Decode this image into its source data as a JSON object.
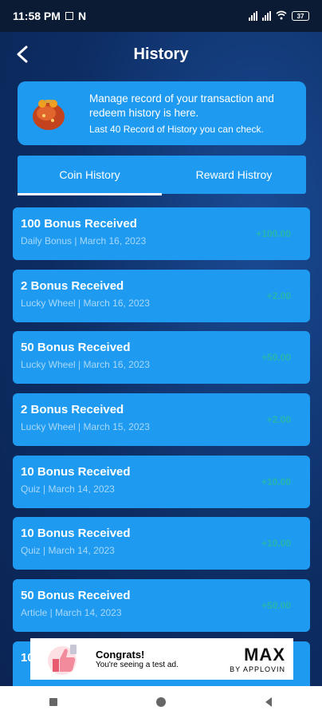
{
  "status_bar": {
    "time": "11:58 PM",
    "indicators": "N",
    "battery": "37"
  },
  "header": {
    "title": "History",
    "back_icon": "chevron-left-icon"
  },
  "info": {
    "line1": "Manage record of your transaction and redeem history is here.",
    "line2": "Last 40 Record of History you can check."
  },
  "tabs": [
    {
      "label": "Coin History",
      "active": true
    },
    {
      "label": "Reward Histroy",
      "active": false
    }
  ],
  "history": [
    {
      "title": "100 Bonus Received",
      "subtitle": "Daily Bonus | March 16, 2023",
      "amount": "+100.00"
    },
    {
      "title": "2 Bonus Received",
      "subtitle": "Lucky Wheel | March 16, 2023",
      "amount": "+2.00"
    },
    {
      "title": "50 Bonus Received",
      "subtitle": "Lucky Wheel | March 16, 2023",
      "amount": "+50.00"
    },
    {
      "title": "2 Bonus Received",
      "subtitle": "Lucky Wheel | March 15, 2023",
      "amount": "+2.00"
    },
    {
      "title": "10 Bonus Received",
      "subtitle": "Quiz | March 14, 2023",
      "amount": "+10.00"
    },
    {
      "title": "10 Bonus Received",
      "subtitle": "Quiz | March 14, 2023",
      "amount": "+10.00"
    },
    {
      "title": "50 Bonus Received",
      "subtitle": "Article | March 14, 2023",
      "amount": "+50.00"
    },
    {
      "title": "10",
      "subtitle": "",
      "amount": ""
    }
  ],
  "ad": {
    "title": "Congrats!",
    "subtitle": "You're seeing a test ad.",
    "brand": "MAX",
    "brand_sub": "BY APPLOVIN"
  },
  "colors": {
    "card": "#1e9bf0",
    "amount": "#33d06b",
    "background": "#0d2d63"
  }
}
